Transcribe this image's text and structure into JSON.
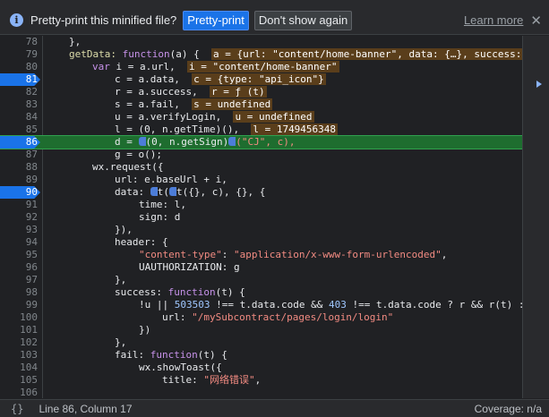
{
  "infobar": {
    "message": "Pretty-print this minified file?",
    "pretty_print_label": "Pretty-print",
    "dont_show_label": "Don't show again",
    "learn_more_label": "Learn more",
    "info_icon": "info-icon",
    "close_icon": "close-icon"
  },
  "editor": {
    "current_line": 86,
    "breakpoint_lines": [
      81,
      86,
      90
    ],
    "lines": [
      {
        "n": "78"
      },
      {
        "n": "79"
      },
      {
        "n": "80"
      },
      {
        "n": "81"
      },
      {
        "n": "82"
      },
      {
        "n": "83"
      },
      {
        "n": "84"
      },
      {
        "n": "85"
      },
      {
        "n": "86"
      },
      {
        "n": "87"
      },
      {
        "n": "88"
      },
      {
        "n": "89"
      },
      {
        "n": "90"
      },
      {
        "n": "91"
      },
      {
        "n": "92"
      },
      {
        "n": "93"
      },
      {
        "n": "94"
      },
      {
        "n": "95"
      },
      {
        "n": "96"
      },
      {
        "n": "97"
      },
      {
        "n": "98"
      },
      {
        "n": "99"
      },
      {
        "n": "100"
      },
      {
        "n": "101"
      },
      {
        "n": "102"
      },
      {
        "n": "103"
      },
      {
        "n": "104"
      },
      {
        "n": "105"
      },
      {
        "n": "106"
      }
    ],
    "text": {
      "l78": "},",
      "l79_a": "getData: ",
      "l79_b": "function",
      "l79_c": "(a) {  ",
      "l79_inline": "a = {url: \"content/home-banner\", data: {…}, success:",
      "l80_a": "var",
      "l80_b": " i = a.url,  ",
      "l80_inline": "i = \"content/home-banner\"",
      "l81_a": "c = a.data,  ",
      "l81_inline": "c = {type: \"api_icon\"}",
      "l82_a": "r = a.success,  ",
      "l82_inline": "r = ƒ (t)",
      "l83_a": "s = a.fail,  ",
      "l83_inline": "s = undefined",
      "l84_a": "u = a.verifyLogin,  ",
      "l84_inline": "u = undefined",
      "l85_a": "l = (0, n.getTime)(),  ",
      "l85_inline": "l = 1749456348",
      "l86_a": "d = ",
      "l86_b": "(0, n.getSign)",
      "l86_c": "(\"CJ\", c),",
      "l87": "g = o();",
      "l88": "wx.request({",
      "l89": "url: e.baseUrl + i,",
      "l90_a": "data: ",
      "l90_b": "t(",
      "l90_c": "t({}, c), {}, {",
      "l91": "time: l,",
      "l92": "sign: d",
      "l93": "}),",
      "l94": "header: {",
      "l95_a": "\"content-type\"",
      "l95_b": ": ",
      "l95_c": "\"application/x-www-form-urlencoded\"",
      "l95_d": ",",
      "l96": "UAUTHORIZATION: g",
      "l97": "},",
      "l98_a": "success: ",
      "l98_b": "function",
      "l98_c": "(t) {",
      "l99_a": "!u || ",
      "l99_b": "503503",
      "l99_c": " !== t.data.code && ",
      "l99_d": "403",
      "l99_e": " !== t.data.code ? r && r(t) :",
      "l100_a": "url: ",
      "l100_b": "\"/mySubcontract/pages/login/login\"",
      "l101": "})",
      "l102": "},",
      "l103_a": "fail: ",
      "l103_b": "function",
      "l103_c": "(t) {",
      "l104": "wx.showToast({",
      "l105_a": "title: ",
      "l105_b": "\"网络错误\"",
      "l105_c": ","
    }
  },
  "statusbar": {
    "braces_icon": "pretty-print-braces-icon",
    "braces": "{}",
    "position": "Line 86, Column 17",
    "coverage": "Coverage: n/a"
  },
  "top_strip": {
    "tab_fragment_1": "…… ……",
    "tab_fragment_2": "……",
    "tab_fragment_3": "……"
  },
  "colors": {
    "accent": "#1a73e8",
    "current_line": "#1e6d2f",
    "inline_value_bg": "#5a3e1b",
    "string": "#f28b82",
    "keyword": "#c792ea"
  }
}
